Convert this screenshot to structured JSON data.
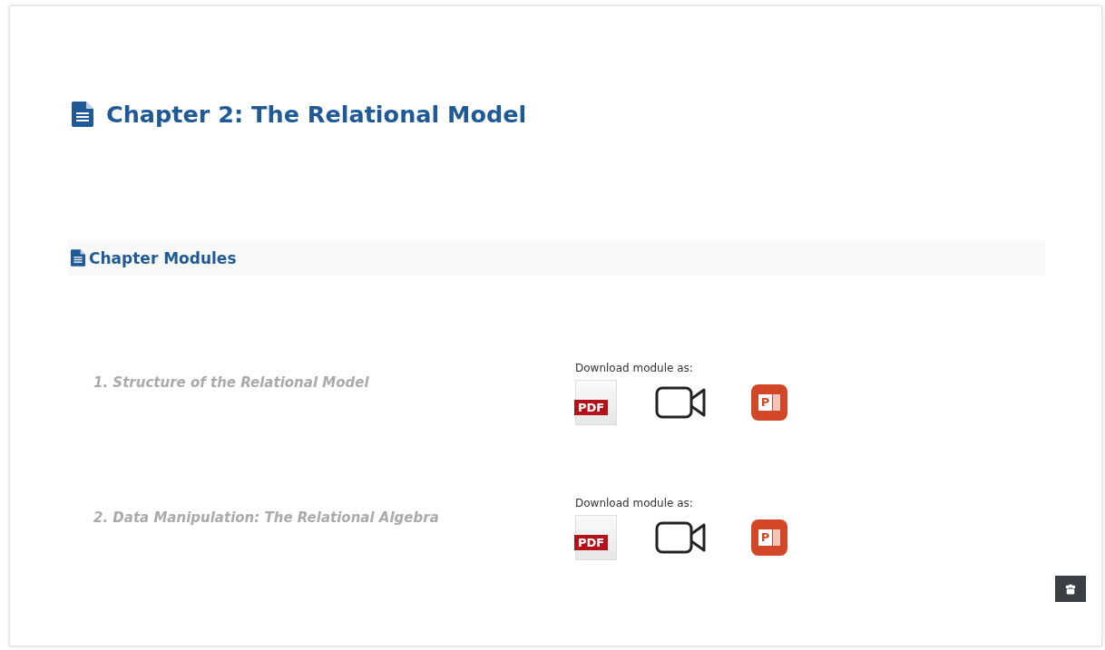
{
  "page": {
    "title": "Chapter 2: The Relational Model"
  },
  "section": {
    "title": "Chapter Modules"
  },
  "modules": [
    {
      "title": "1. Structure of the Relational Model",
      "download_label": "Download module as:",
      "files": [
        {
          "kind": "pdf",
          "label": "PDF"
        },
        {
          "kind": "video"
        },
        {
          "kind": "ppt",
          "label": "P"
        }
      ]
    },
    {
      "title": "2. Data Manipulation: The Relational Algebra",
      "download_label": "Download module as:",
      "files": [
        {
          "kind": "pdf",
          "label": "PDF"
        },
        {
          "kind": "video"
        },
        {
          "kind": "ppt",
          "label": "P"
        }
      ]
    }
  ]
}
